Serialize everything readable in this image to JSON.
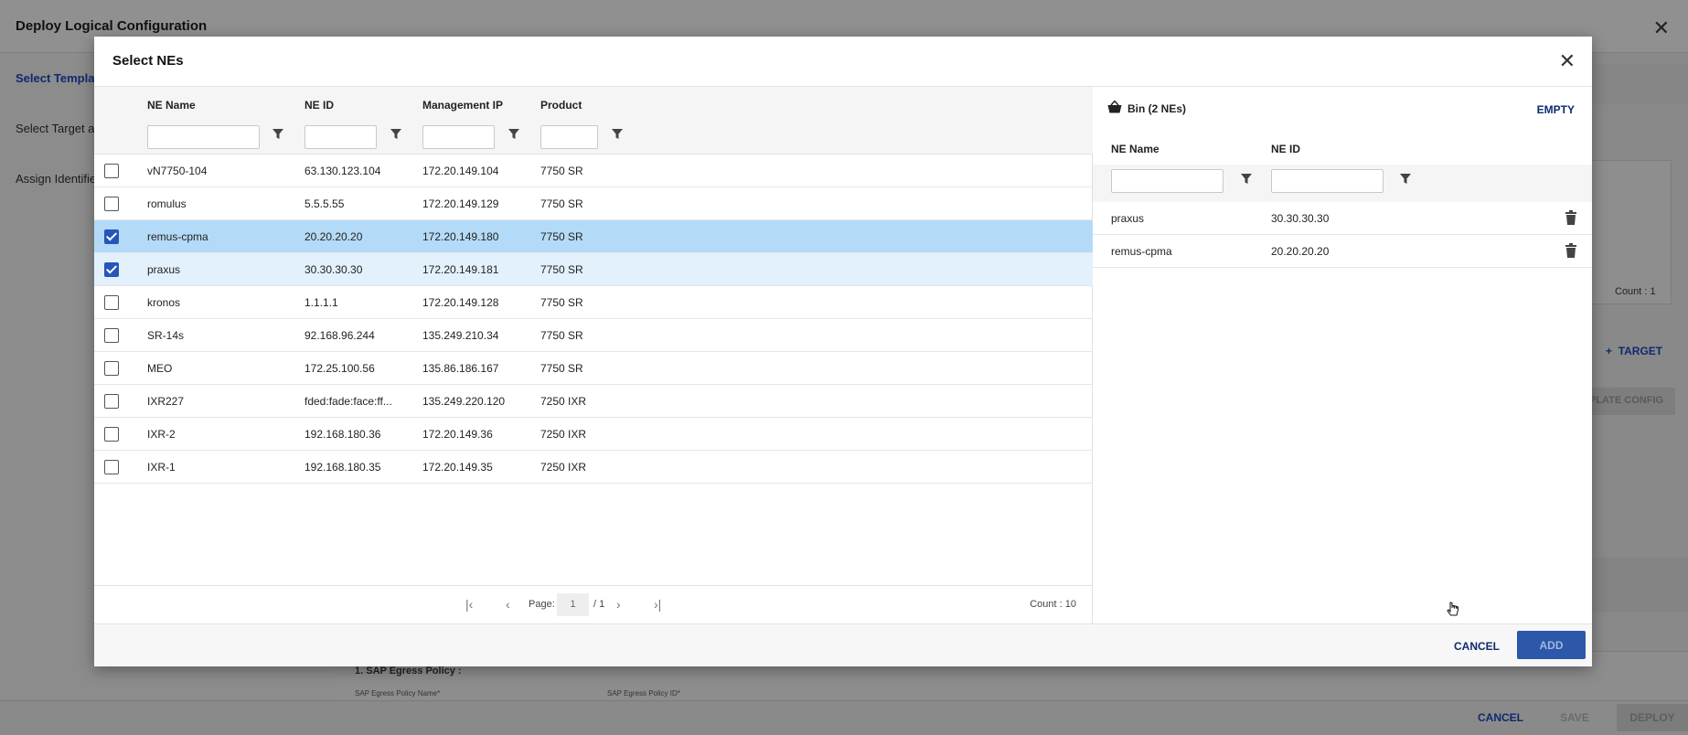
{
  "background": {
    "title": "Deploy Logical Configuration",
    "steps": [
      "Select Template",
      "Select Target an",
      "Assign Identifier"
    ],
    "count_label": "Count : 1",
    "target_button": "TARGET",
    "template_config_button": "PLATE CONFIG",
    "sap_title": "1. SAP Egress Policy :",
    "sap_field1": "SAP Egress Policy Name*",
    "sap_field2": "SAP Egress Policy ID*",
    "footer": {
      "cancel": "CANCEL",
      "save": "SAVE",
      "deploy": "DEPLOY"
    }
  },
  "modal": {
    "title": "Select NEs",
    "columns": [
      "NE Name",
      "NE ID",
      "Management IP",
      "Product"
    ],
    "rows": [
      {
        "name": "vN7750-104",
        "ne_id": "63.130.123.104",
        "ip": "172.20.149.104",
        "product": "7750 SR",
        "checked": false
      },
      {
        "name": "romulus",
        "ne_id": "5.5.5.55",
        "ip": "172.20.149.129",
        "product": "7750 SR",
        "checked": false
      },
      {
        "name": "remus-cpma",
        "ne_id": "20.20.20.20",
        "ip": "172.20.149.180",
        "product": "7750 SR",
        "checked": true
      },
      {
        "name": "praxus",
        "ne_id": "30.30.30.30",
        "ip": "172.20.149.181",
        "product": "7750 SR",
        "checked": true
      },
      {
        "name": "kronos",
        "ne_id": "1.1.1.1",
        "ip": "172.20.149.128",
        "product": "7750 SR",
        "checked": false
      },
      {
        "name": "SR-14s",
        "ne_id": "92.168.96.244",
        "ip": "135.249.210.34",
        "product": "7750 SR",
        "checked": false
      },
      {
        "name": "MEO",
        "ne_id": "172.25.100.56",
        "ip": "135.86.186.167",
        "product": "7750 SR",
        "checked": false
      },
      {
        "name": "IXR227",
        "ne_id": "fded:fade:face:ff...",
        "ip": "135.249.220.120",
        "product": "7250 IXR",
        "checked": false
      },
      {
        "name": "IXR-2",
        "ne_id": "192.168.180.36",
        "ip": "172.20.149.36",
        "product": "7250 IXR",
        "checked": false
      },
      {
        "name": "IXR-1",
        "ne_id": "192.168.180.35",
        "ip": "172.20.149.35",
        "product": "7250 IXR",
        "checked": false
      }
    ],
    "pager": {
      "page_label": "Page:",
      "page": "1",
      "total": "/ 1",
      "count": "Count : 10"
    },
    "bin": {
      "title": "Bin (2 NEs)",
      "empty_label": "EMPTY",
      "columns": [
        "NE Name",
        "NE ID"
      ],
      "rows": [
        {
          "name": "praxus",
          "ne_id": "30.30.30.30"
        },
        {
          "name": "remus-cpma",
          "ne_id": "20.20.20.20"
        }
      ]
    },
    "footer": {
      "cancel": "CANCEL",
      "add": "ADD"
    }
  },
  "colors": {
    "accent": "#2d57a8",
    "selected_row": "#b3dbf7",
    "selected_row_light": "#e2f1fc",
    "link": "#0d2a6e"
  }
}
